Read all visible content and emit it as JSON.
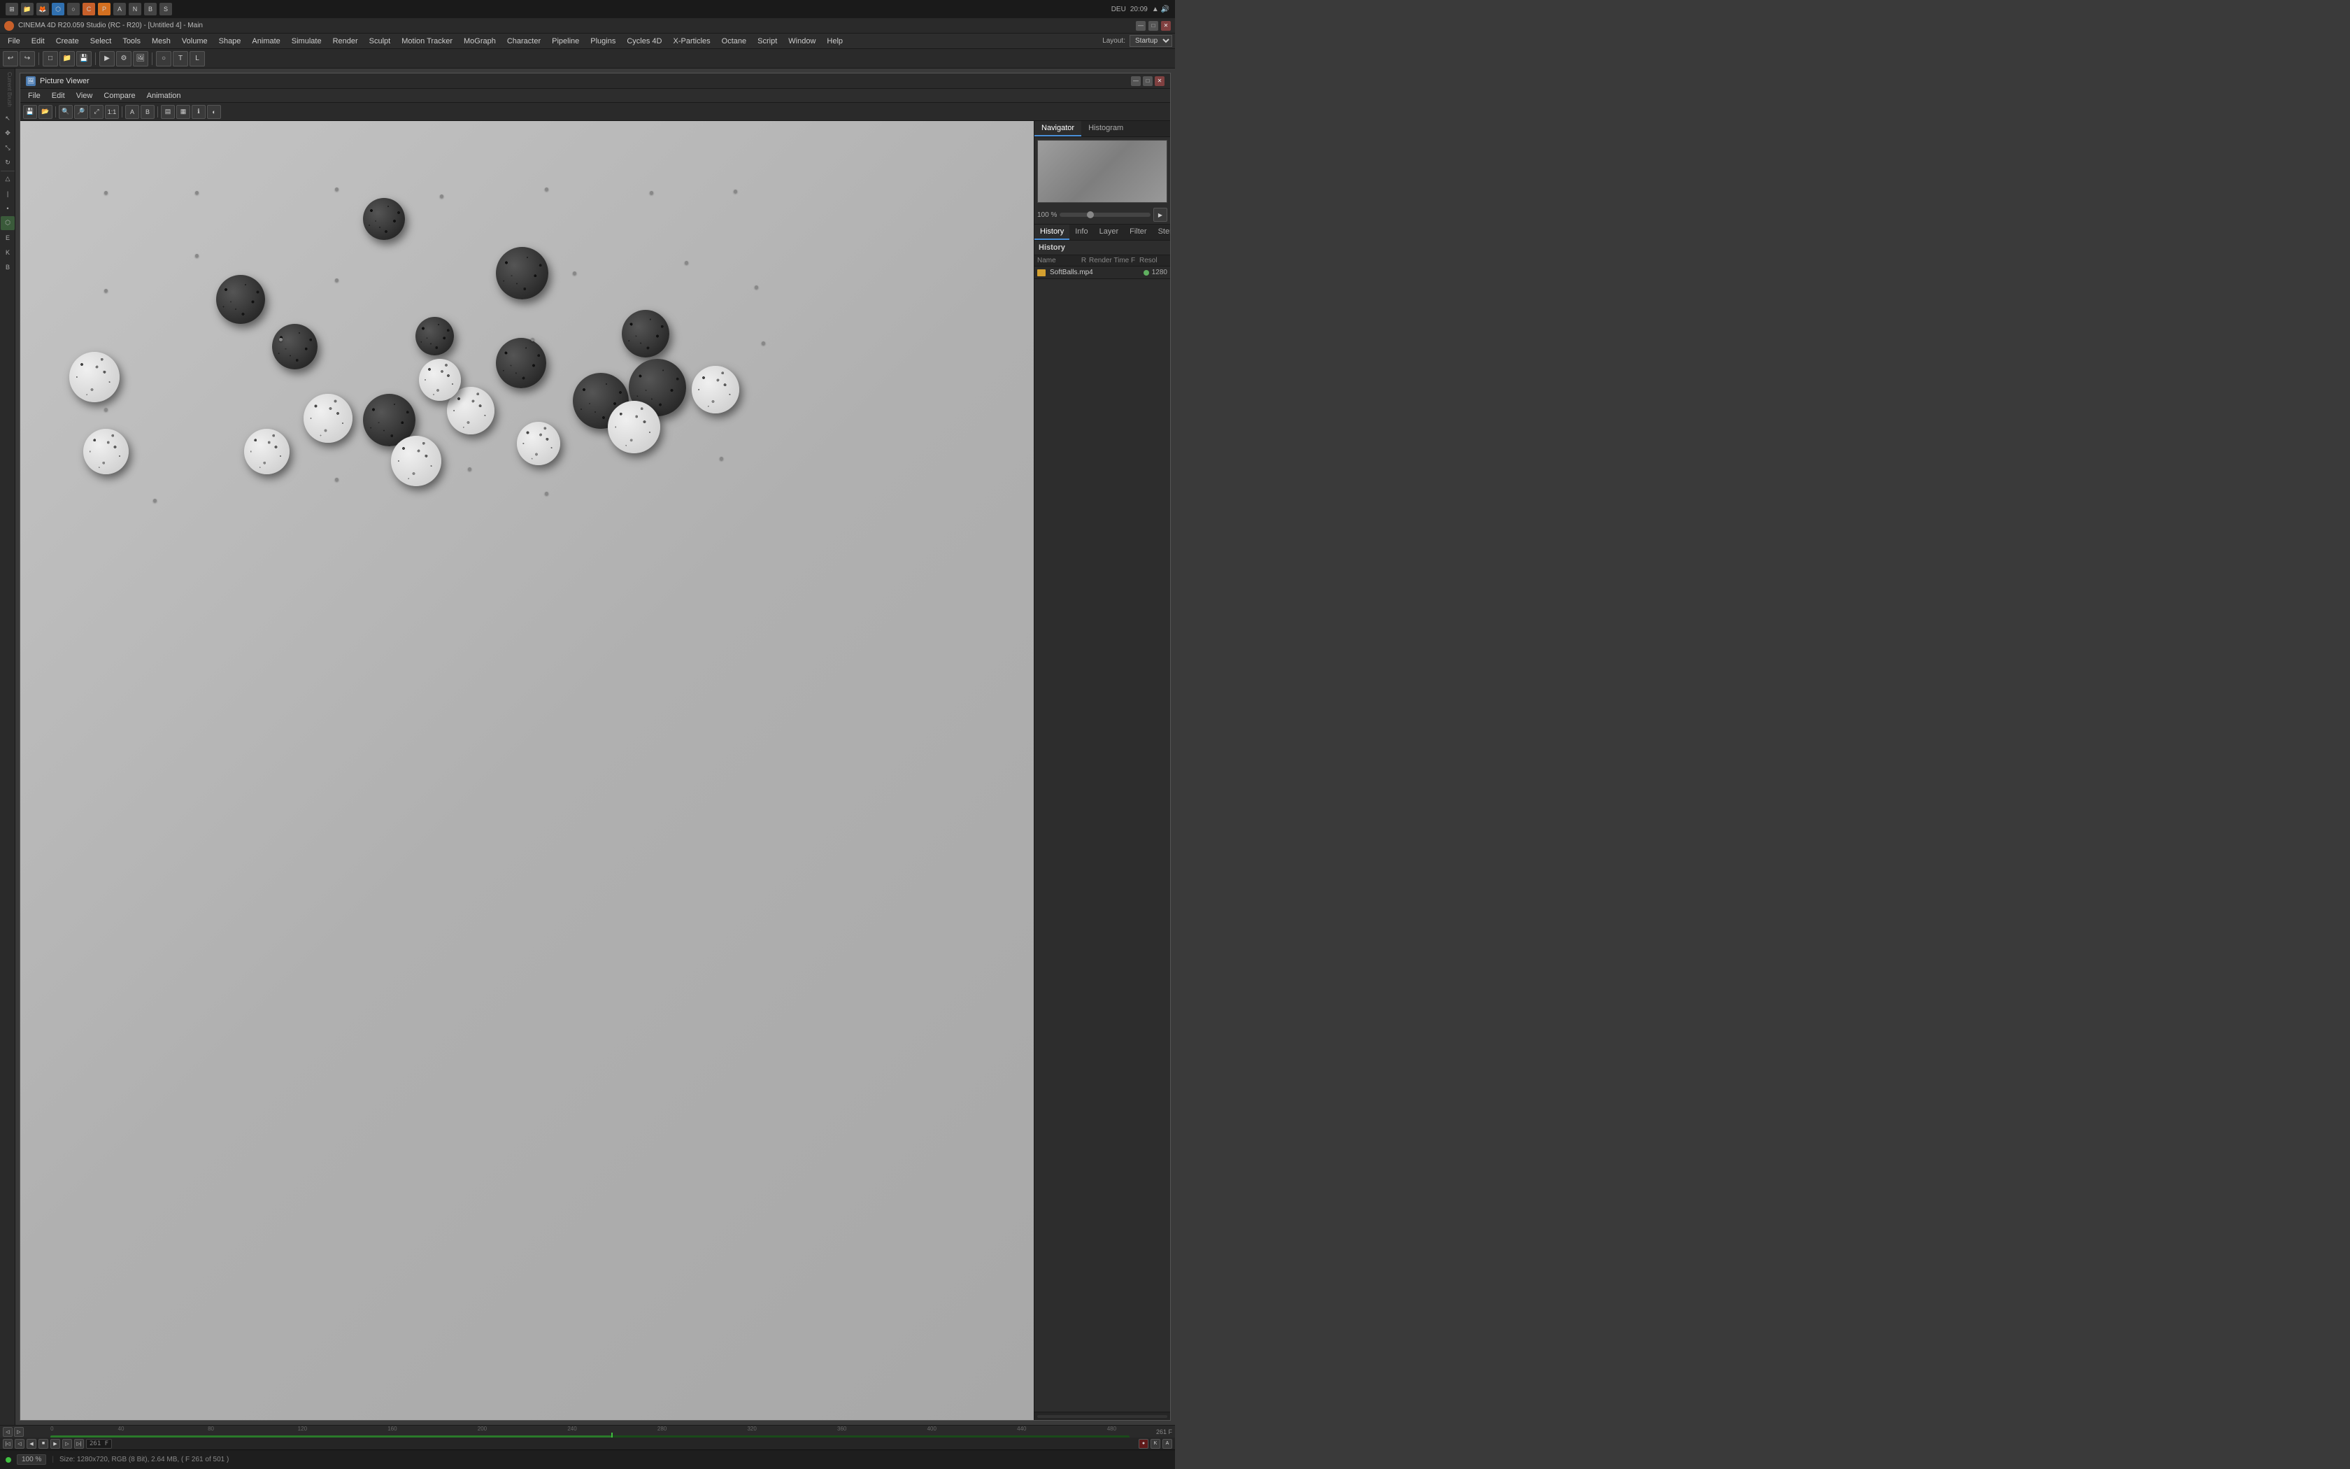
{
  "os_bar": {
    "icons": [
      "⊞",
      "📁",
      "🦊",
      "⬡",
      "🔵",
      "📊",
      "🔴",
      "🎨",
      "📷",
      "⬛",
      "🔶",
      "🟥"
    ],
    "time": "20:09",
    "lang": "DEU"
  },
  "app": {
    "title": "CINEMA 4D R20.059 Studio (RC - R20) - [Untitled 4] - Main",
    "logo": "C4D"
  },
  "menu": {
    "items": [
      "File",
      "Edit",
      "Create",
      "Select",
      "Tools",
      "Mesh",
      "Volume",
      "Shape",
      "Animate",
      "Simulate",
      "Render",
      "Sculpt",
      "Motion Tracker",
      "MoGraph",
      "Character",
      "Pipeline",
      "Plugins",
      "Cycles 4D",
      "X-Particles",
      "Octane",
      "Script",
      "Window",
      "Help"
    ]
  },
  "toolbar": {
    "layout_label": "Layout:",
    "layout_value": "Startup"
  },
  "picture_viewer": {
    "title": "Picture Viewer",
    "menus": [
      "File",
      "Edit",
      "View",
      "Compare",
      "Animation"
    ],
    "nav_tabs": [
      "Navigator",
      "Histogram"
    ],
    "history_tabs": [
      "History",
      "Info",
      "Layer",
      "Filter",
      "Stereo"
    ],
    "history_title": "History",
    "history_columns": {
      "name": "Name",
      "r": "R",
      "render_time": "Render Time",
      "f": "F",
      "resolution": "Resol"
    },
    "history_items": [
      {
        "name": "SoftBalls.mp4",
        "r": "●",
        "resolution": "1280"
      }
    ],
    "zoom_level": "100 %",
    "status_text": "Size: 1280x720, RGB (8 Bit), 2.64 MB, ( F 261 of 501 )",
    "zoom_display": "100 %"
  },
  "timeline": {
    "markers": [
      "0",
      "40",
      "80",
      "120",
      "160",
      "200",
      "240",
      "280",
      "320",
      "360",
      "400",
      "440",
      "480",
      ".."
    ],
    "timecode": "261 F",
    "frame_indicator": "261 F"
  },
  "status": {
    "zoom": "100 %",
    "info": "Size: 1280x720, RGB (8 Bit), 2.64 MB, ( F 261 of 501 )"
  }
}
